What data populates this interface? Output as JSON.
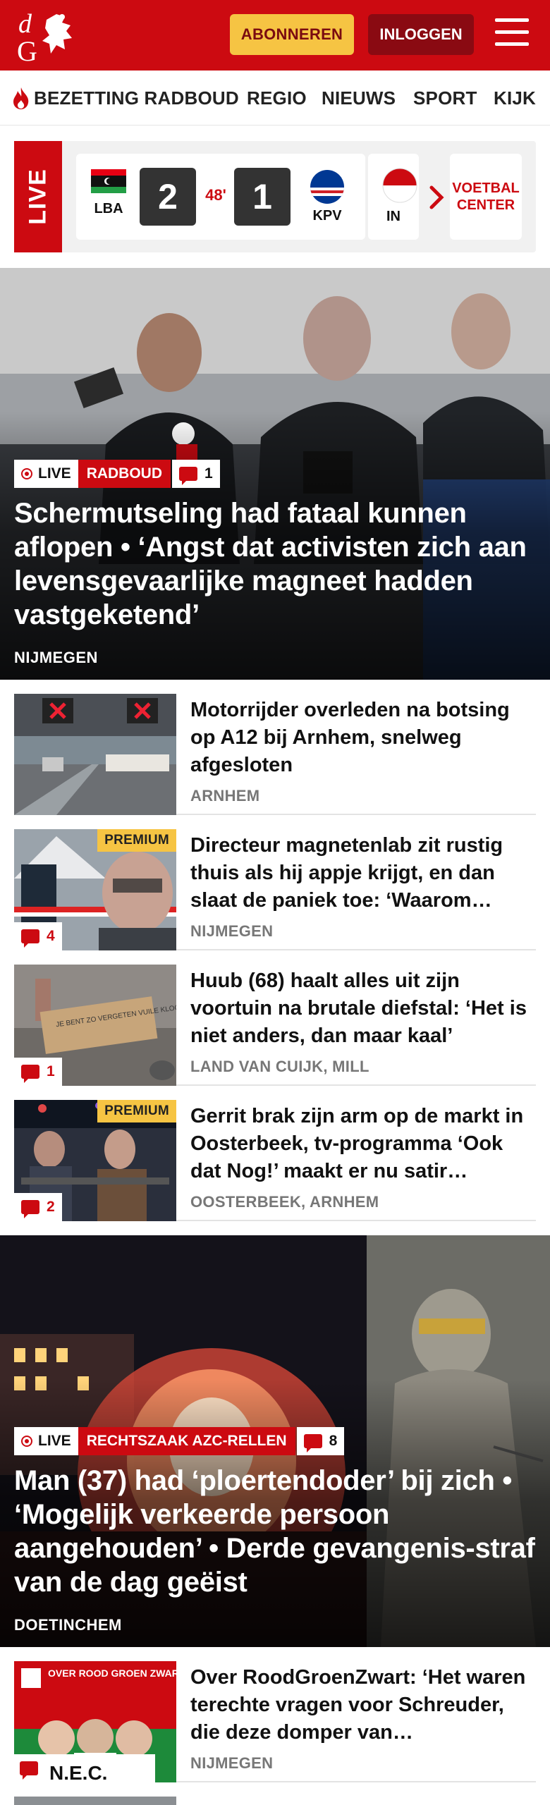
{
  "header": {
    "logo_text": "dG",
    "subscribe_label": "ABONNEREN",
    "login_label": "INLOGGEN",
    "colors": {
      "brand": "#cc0a11",
      "subscribe": "#f6c443",
      "login": "#8a0a12"
    }
  },
  "nav": {
    "items": [
      "BEZETTING RADBOUD",
      "REGIO",
      "NIEUWS",
      "SPORT",
      "KIJK"
    ]
  },
  "live_strip": {
    "label": "LIVE",
    "match": {
      "home_code": "LBA",
      "home_score": "2",
      "minute": "48'",
      "away_score": "1",
      "away_code": "KPV"
    },
    "next_match_code_partial": "IN",
    "center_button": "VOETBAL CENTER"
  },
  "hero1": {
    "live_label": "LIVE",
    "category": "RADBOUD",
    "comments": "1",
    "title": "Schermutseling had fataal kunnen aflopen • ‘Angst dat activisten zich aan levensgevaarlijke magneet hadden vastgeketend’",
    "location": "NIJMEGEN"
  },
  "articles": [
    {
      "title": "Motorrijder overleden na botsing op A12 bij Arnhem, snelweg afgesloten",
      "location": "ARNHEM",
      "premium": "",
      "comments": ""
    },
    {
      "title": "Directeur magnetenlab zit rustig thuis als hij appje krijgt, en dan slaat de paniek toe: ‘Waarom…",
      "location": "NIJMEGEN",
      "premium": "PREMIUM",
      "comments": "4"
    },
    {
      "title": "Huub (68) haalt alles uit zijn voortuin na brutale diefstal: ‘Het is niet anders, dan maar kaal’",
      "location": "LAND VAN CUIJK, MILL",
      "premium": "",
      "comments": "1",
      "thumb_text": "JE BENT ZO VERGETEN VUILE KLOOTZAK"
    },
    {
      "title": "Gerrit brak zijn arm op de markt in Oosterbeek, tv-programma ‘Ook dat Nog!’ maakt er nu satir…",
      "location": "OOSTERBEEK, ARNHEM",
      "premium": "PREMIUM",
      "comments": "2"
    }
  ],
  "hero2": {
    "live_label": "LIVE",
    "category": "RECHTSZAAK AZC-RELLEN",
    "comments": "8",
    "title": "Man (37) had ‘ploertendoder’ bij zich • ‘Mogelijk verkeerde persoon aangehouden’ • Derde gevangenis-straf van de dag geëist",
    "location": "DOETINCHEM"
  },
  "article5": {
    "title": "Over RoodGroenZwart: ‘Het waren terechte vragen voor Schreuder, die deze domper van…",
    "location": "NIJMEGEN",
    "thumb_label": "OVER ROOD GROEN ZWART",
    "thumb_letters": "N.E.C."
  }
}
